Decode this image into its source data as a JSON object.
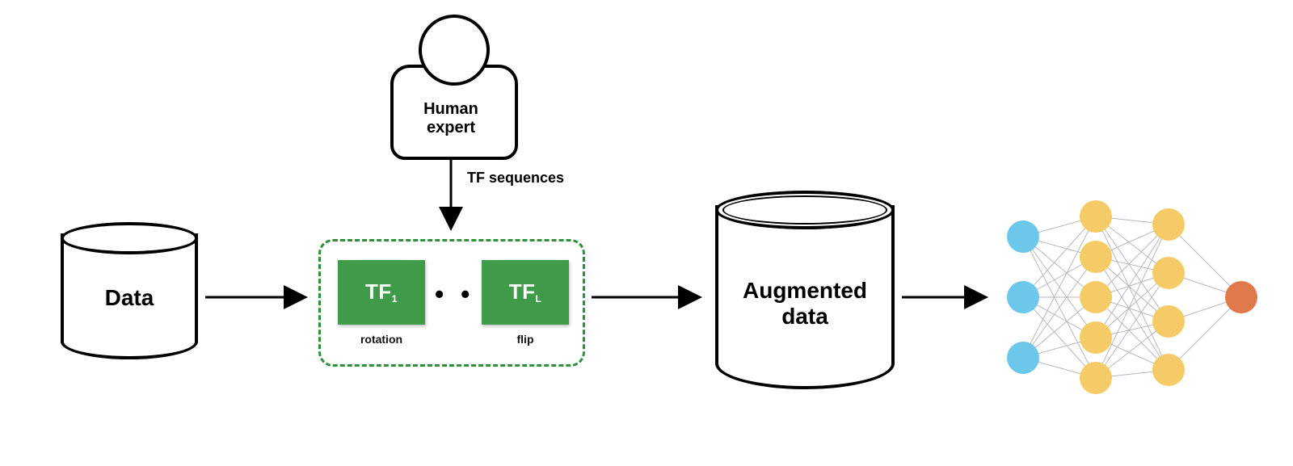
{
  "data_cylinder": {
    "label": "Data"
  },
  "human_expert": {
    "label_line1": "Human",
    "label_line2": "expert"
  },
  "tf_sequences_label": "TF sequences",
  "tf_pipeline": {
    "block1": {
      "prefix": "TF",
      "sub": "1",
      "caption": "rotation"
    },
    "dots": "• • •",
    "block2": {
      "prefix": "TF",
      "sub": "L",
      "caption": "flip"
    }
  },
  "augmented_cylinder": {
    "label_line1": "Augmented",
    "label_line2": "data"
  },
  "nn": {
    "colors": {
      "input": "#6cc7ea",
      "hidden": "#f4cb67",
      "output": "#e07a4b",
      "edge": "#b9b9b9"
    },
    "layers": [
      {
        "name": "input",
        "count": 3,
        "color_key": "input"
      },
      {
        "name": "hidden1",
        "count": 5,
        "color_key": "hidden"
      },
      {
        "name": "hidden2",
        "count": 4,
        "color_key": "hidden"
      },
      {
        "name": "output",
        "count": 1,
        "color_key": "output"
      }
    ]
  }
}
